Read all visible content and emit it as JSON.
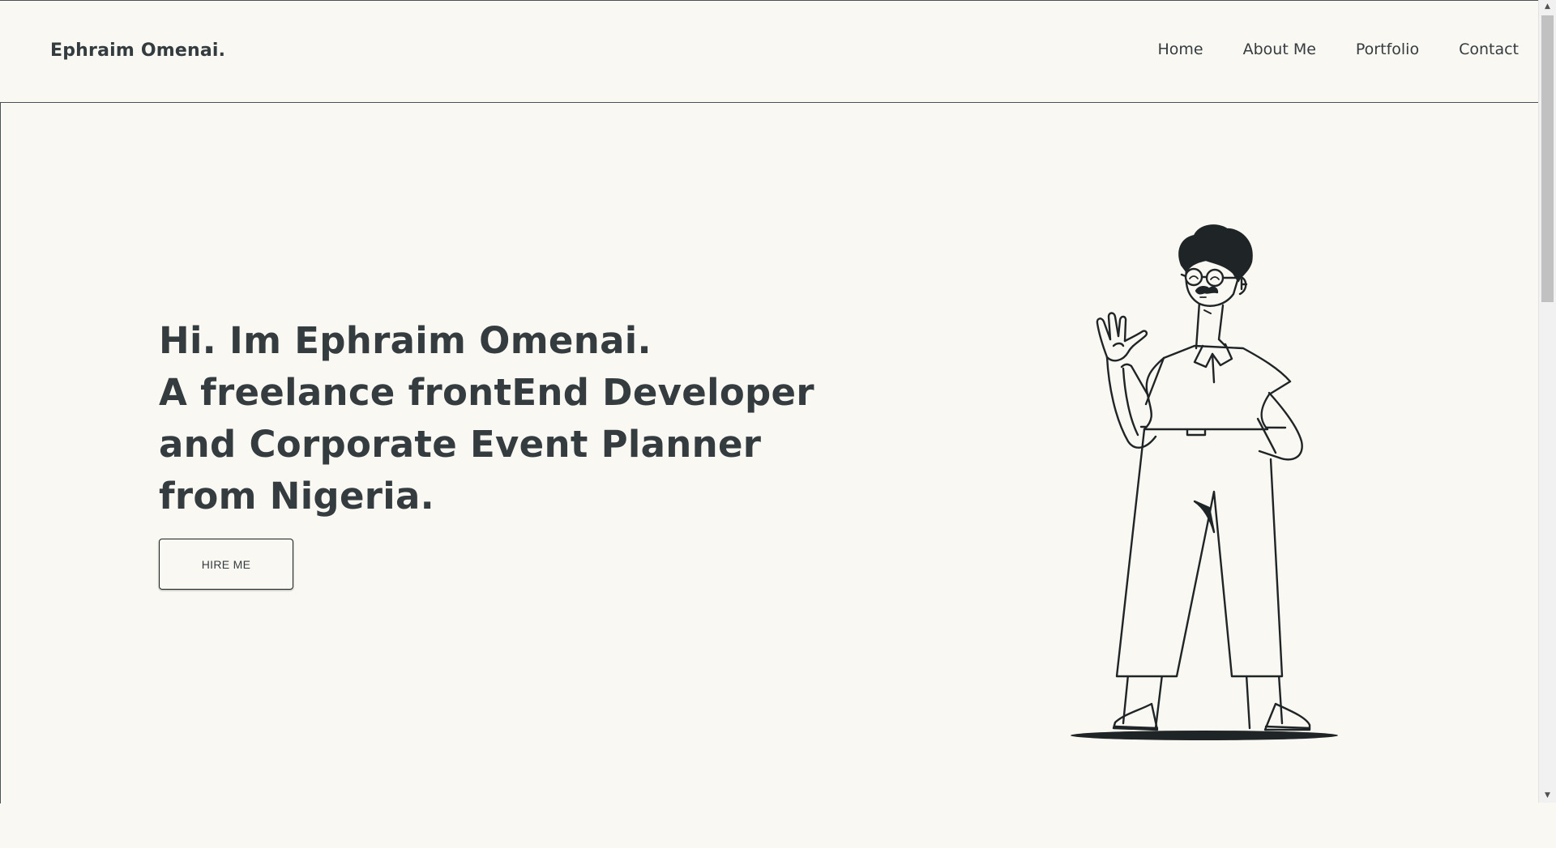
{
  "header": {
    "brand": "Ephraim Omenai.",
    "nav": [
      {
        "label": "Home"
      },
      {
        "label": "About Me"
      },
      {
        "label": "Portfolio"
      },
      {
        "label": "Contact"
      }
    ]
  },
  "hero": {
    "heading_lines": [
      "Hi. Im Ephraim Omenai.",
      "A freelance frontEnd Developer",
      "and Corporate Event Planner",
      "from Nigeria."
    ],
    "cta_label": "HIRE ME"
  },
  "scrollbar": {
    "up_arrow": "▲",
    "down_arrow": "▼"
  },
  "colors": {
    "background": "#faf8f2",
    "text": "#343c3f",
    "border": "#4a5156"
  }
}
